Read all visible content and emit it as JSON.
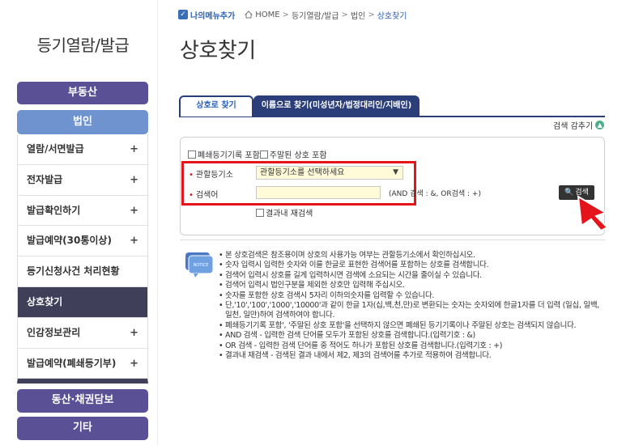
{
  "breadcrumb": {
    "my_menu": "나의메뉴추가",
    "home": "HOME",
    "sep": ">",
    "level1": "등기열람/발급",
    "level2": "법인",
    "current": "상호찾기"
  },
  "sidebar": {
    "title": "등기열람/발급",
    "realestate": "부동산",
    "corporation": "법인",
    "items": [
      {
        "label": "열람/서면발급",
        "plus": "+"
      },
      {
        "label": "전자발급",
        "plus": "+"
      },
      {
        "label": "발급확인하기",
        "plus": "+"
      },
      {
        "label": "발급예약(30통이상)",
        "plus": "+"
      },
      {
        "label": "등기신청사건 처리현황",
        "plus": ""
      },
      {
        "label": "상호찾기",
        "plus": ""
      },
      {
        "label": "인감정보관리",
        "plus": "+"
      },
      {
        "label": "발급예약(폐쇄등기부)",
        "plus": "+"
      }
    ],
    "movable": "동산·채권담보",
    "etc": "기타"
  },
  "page_title": "상호찾기",
  "tabs": {
    "company": "상호로 찾기",
    "name": "이름으로 찾기(미성년자/법정대리인/지배인)"
  },
  "search_toggle": "검색 감추기",
  "filters": {
    "closed": "폐쇄등기기록 포함",
    "terminated": "주말된 상호 포함"
  },
  "fields": {
    "office_label": "관할등기소",
    "office_value": "관할등기소를 선택하세요",
    "keyword_label": "검색어",
    "keyword_value": "",
    "hint": "(AND 검색 : &, OR검색 : +)"
  },
  "search_button": "검색",
  "rescan": "결과내 재검색",
  "notice_badge": "NOTICE",
  "notices": [
    "본 상호검색은 참조용이며 상호의 사용가능 여부는 관할등기소에서 확인하십시오.",
    "숫자 입력시 입력한 숫자와 이를 한글로 표현한 검색어를 포함하는 상호를 검색합니다.",
    "검색어 입력시 상호를 길게 입력하시면 검색에 소요되는 시간을 줄이실 수 있습니다.",
    "검색어 입력시 법인구분을 제외한 상호만 입력해 주십시오.",
    "숫자를 포함한 상호 검색시 5자리 이하의숫자를 입력할 수 있습니다.",
    "단,'10','100','1000','10000'과 같이 한글 1자(십,백,천,만)로 변환되는 숫자는 숫자외에 한글1자를 더 입력 (일십, 일백, 일천, 일만)하여 검색하여야 합니다.",
    "폐쇄등기기록 포함', '주말된 상호 포함'을 선택하지 않으면 폐쇄된 등기기록이나 주말된 상호는 검색되지 않습니다.",
    "AND 검색 - 입력한 검색 단어를 모두가 포함된 상호를 검색합니다.(입력기호 : &)",
    "OR 검색 - 입력한 검색 단어를 중 적어도 하나가 포함된 상호를 검색합니다.(입력기호 : +)",
    "결과내 재검색 - 검색된 결과 내에서 제2, 제3의 검색어를 추가로 적용하여 검색합니다."
  ],
  "colors": {
    "sidebar_pill": "#5a5096",
    "corp_pill": "#6e93cf",
    "active_item": "#3f3f5a",
    "tab_navy": "#2b3e7a",
    "highlight_red": "#e5141b",
    "input_yellow": "#fffbd8"
  }
}
